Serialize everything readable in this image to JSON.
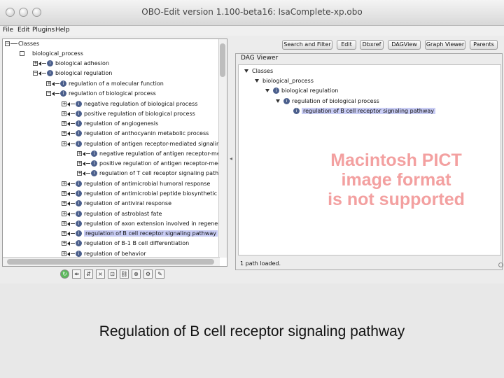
{
  "window": {
    "title": "OBO-Edit version 1.100-beta16: IsaComplete-xp.obo"
  },
  "menu": [
    "File",
    "Edit",
    "Plugins",
    "Help"
  ],
  "tree": {
    "items": [
      {
        "label": "Classes",
        "box": "−",
        "rel": ""
      },
      {
        "label": "biological_process",
        "box": "",
        "rel": ""
      },
      {
        "label": "biological adhesion",
        "box": "+",
        "rel": "i"
      },
      {
        "label": "biological regulation",
        "box": "−",
        "rel": "i"
      },
      {
        "label": "regulation of a molecular function",
        "box": "+",
        "rel": "i"
      },
      {
        "label": "regulation of biological process",
        "box": "−",
        "rel": "i"
      },
      {
        "label": "negative regulation of biological process",
        "box": "+",
        "rel": "i"
      },
      {
        "label": "positive regulation of biological process",
        "box": "+",
        "rel": "i"
      },
      {
        "label": "regulation of angiogenesis",
        "box": "+",
        "rel": "i"
      },
      {
        "label": "regulation of anthocyanin metabolic process",
        "box": "+",
        "rel": "i"
      },
      {
        "label": "regulation of antigen receptor-mediated signaling pa",
        "box": "+",
        "rel": "i"
      },
      {
        "label": "negative regulation of antigen receptor-mediat",
        "box": "+",
        "rel": "i"
      },
      {
        "label": "positive regulation of antigen receptor-mediat",
        "box": "+",
        "rel": "i"
      },
      {
        "label": "regulation of T cell receptor signaling pathway",
        "box": "+",
        "rel": "i"
      },
      {
        "label": "regulation of antimicrobial humoral response",
        "box": "+",
        "rel": "i"
      },
      {
        "label": "regulation of antimicrobial peptide biosynthetic proce",
        "box": "+",
        "rel": "i"
      },
      {
        "label": "regulation of antiviral response",
        "box": "+",
        "rel": "i"
      },
      {
        "label": "regulation of astroblast fate",
        "box": "+",
        "rel": "i"
      },
      {
        "label": "regulation of axon extension involved in regeneration",
        "box": "+",
        "rel": "i"
      },
      {
        "label": "regulation of B cell receptor signaling pathway",
        "box": "+",
        "rel": "i"
      },
      {
        "label": "regulation of B-1 B cell differentiation",
        "box": "+",
        "rel": "i"
      },
      {
        "label": "regulation of behavior",
        "box": "+",
        "rel": "i"
      }
    ]
  },
  "tabs": [
    "Search and Filter",
    "Edit",
    "Dbxref",
    "DAGView",
    "Graph Viewer",
    "Parents"
  ],
  "dag": {
    "title": "DAG Viewer",
    "items": [
      {
        "label": "Classes",
        "rel": ""
      },
      {
        "label": "biological_process",
        "rel": ""
      },
      {
        "label": "biological regulation",
        "rel": "i"
      },
      {
        "label": "regulation of biological process",
        "rel": "i"
      },
      {
        "label": "regulation of B cell receptor signaling pathway",
        "rel": "i"
      }
    ],
    "pict_message": [
      "Macintosh PICT",
      "image format",
      "is not supported"
    ],
    "status": "1 path loaded."
  },
  "caption": "Regulation of B cell receptor signaling pathway",
  "colors": {
    "selection": "#c9cdf5",
    "pict_text": "#f3a0a0",
    "relation_badge": "#4b5f8c"
  }
}
